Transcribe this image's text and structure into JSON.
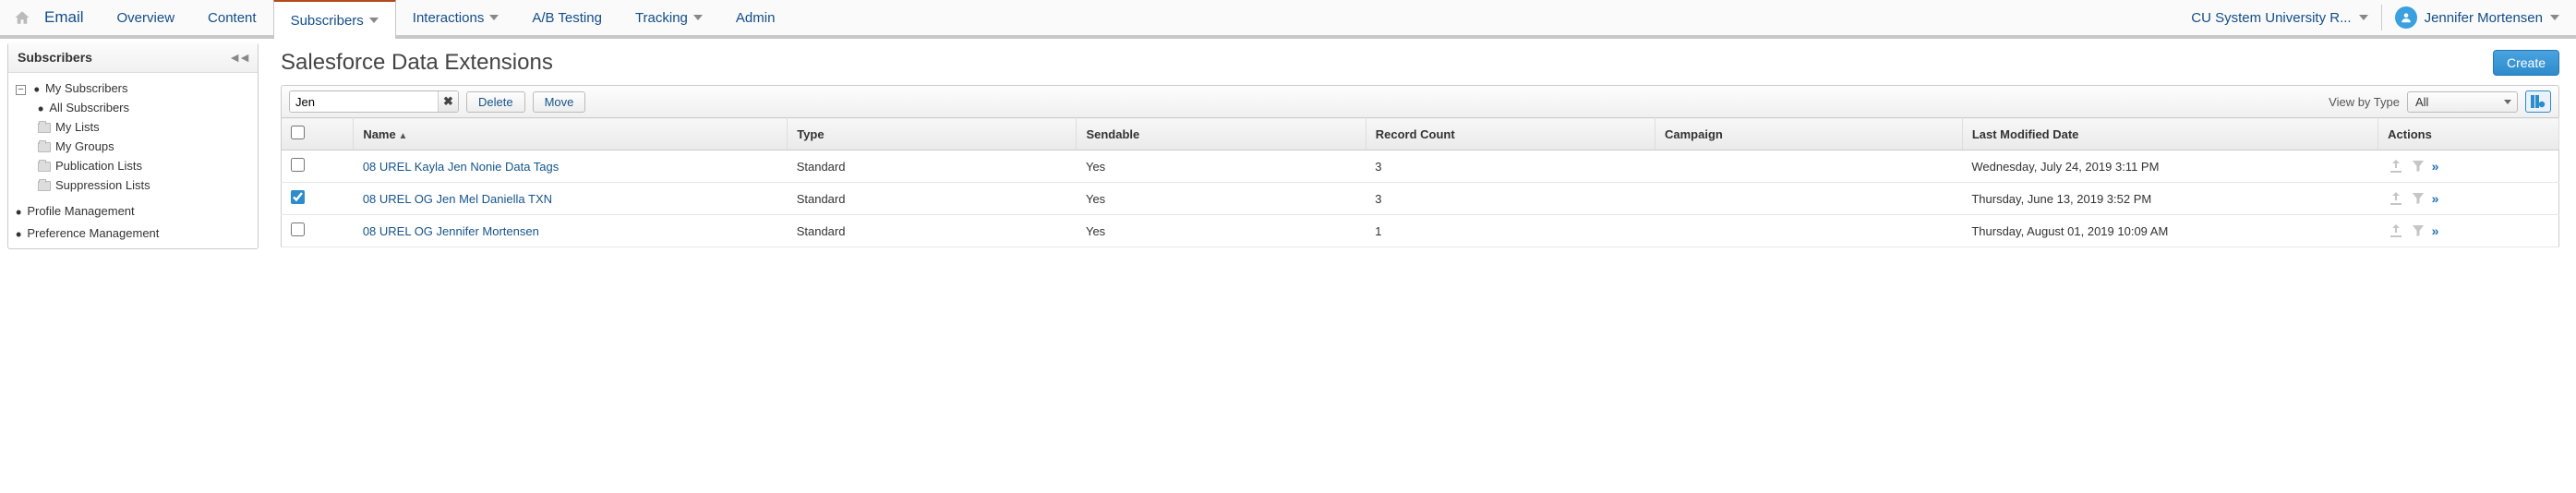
{
  "topnav": {
    "app_label": "Email",
    "tabs": [
      {
        "label": "Overview",
        "dropdown": false,
        "active": false
      },
      {
        "label": "Content",
        "dropdown": false,
        "active": false
      },
      {
        "label": "Subscribers",
        "dropdown": true,
        "active": true
      },
      {
        "label": "Interactions",
        "dropdown": true,
        "active": false
      },
      {
        "label": "A/B Testing",
        "dropdown": false,
        "active": false
      },
      {
        "label": "Tracking",
        "dropdown": true,
        "active": false
      },
      {
        "label": "Admin",
        "dropdown": false,
        "active": false
      }
    ],
    "account_label": "CU System University R...",
    "user_label": "Jennifer Mortensen"
  },
  "sidebar": {
    "title": "Subscribers",
    "tree": {
      "my_subscribers": "My Subscribers",
      "all_subscribers": "All Subscribers",
      "my_lists": "My Lists",
      "my_groups": "My Groups",
      "publication_lists": "Publication Lists",
      "suppression_lists": "Suppression Lists",
      "profile_management": "Profile Management",
      "preference_management": "Preference Management"
    }
  },
  "content": {
    "title": "Salesforce Data Extensions",
    "create_label": "Create",
    "toolbar": {
      "search_value": "Jen",
      "delete_label": "Delete",
      "move_label": "Move",
      "view_by_type_label": "View by Type",
      "type_select_value": "All"
    },
    "columns": {
      "name": "Name",
      "type": "Type",
      "sendable": "Sendable",
      "record_count": "Record Count",
      "campaign": "Campaign",
      "last_modified": "Last Modified Date",
      "actions": "Actions"
    },
    "rows": [
      {
        "checked": false,
        "name": "08 UREL Kayla Jen Nonie Data Tags",
        "type": "Standard",
        "sendable": "Yes",
        "record_count": "3",
        "campaign": "",
        "last_modified": "Wednesday, July 24, 2019 3:11 PM"
      },
      {
        "checked": true,
        "name": "08 UREL OG Jen Mel Daniella TXN",
        "type": "Standard",
        "sendable": "Yes",
        "record_count": "3",
        "campaign": "",
        "last_modified": "Thursday, June 13, 2019 3:52 PM"
      },
      {
        "checked": false,
        "name": "08 UREL OG Jennifer Mortensen",
        "type": "Standard",
        "sendable": "Yes",
        "record_count": "1",
        "campaign": "",
        "last_modified": "Thursday, August 01, 2019 10:09 AM"
      }
    ]
  }
}
